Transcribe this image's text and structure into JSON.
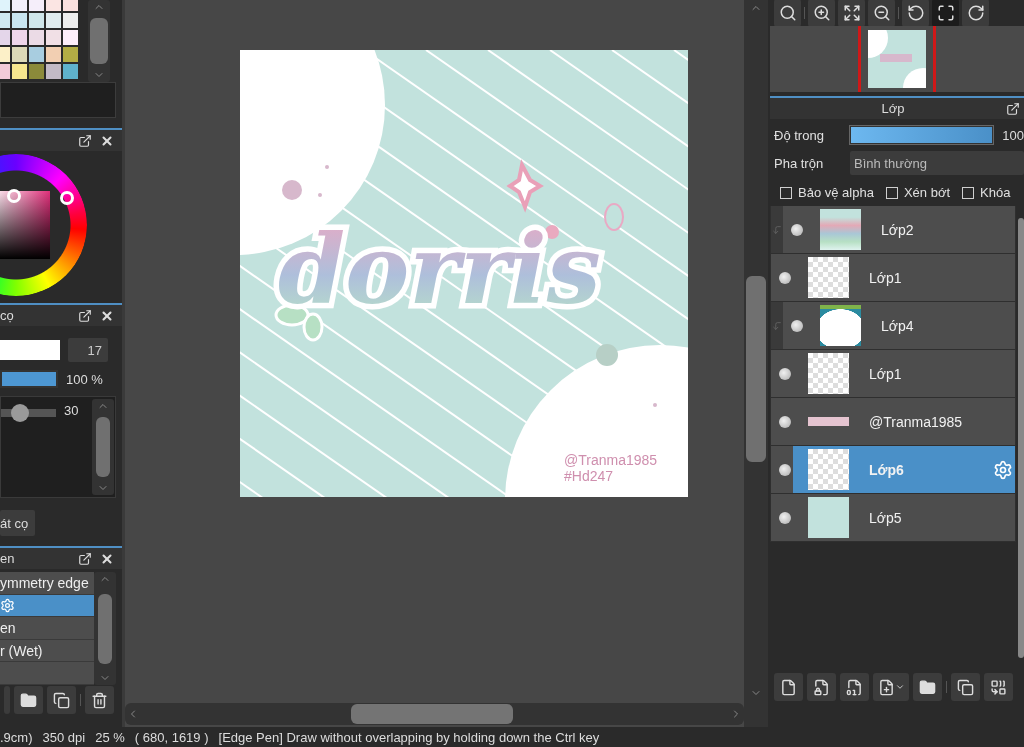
{
  "palette": {
    "swatches": [
      {
        "color": "#dff3fb"
      },
      {
        "color": "#f3f0fb"
      },
      {
        "color": "#f5eefa"
      },
      {
        "color": "#fbe5e3"
      },
      {
        "color": "#fbe1df"
      },
      {
        "color": "#cfe9f1"
      },
      {
        "color": "#c9e6f1"
      },
      {
        "color": "#cfe6ea"
      },
      {
        "color": "#e0ecef"
      },
      {
        "color": "#eeeeee"
      },
      {
        "color": "#e4d6ea"
      },
      {
        "color": "#eed6ea"
      },
      {
        "color": "#ebdbe6"
      },
      {
        "color": "#f1e0e6"
      },
      {
        "color": "#fdeefa"
      },
      {
        "color": "#fcf0c8"
      },
      {
        "color": "#dcd9b8"
      },
      {
        "color": "#a8cde0"
      },
      {
        "color": "#f2cfb2"
      },
      {
        "color": "#b3ad45"
      },
      {
        "color": "#f3cbd8"
      },
      {
        "color": "#f7e78f"
      },
      {
        "color": "#8b8a3a"
      },
      {
        "color": "#c2bac6"
      },
      {
        "color": "#5fb2cc"
      }
    ]
  },
  "brush_panel": {
    "title": "cọ",
    "size": "17",
    "opacity": {
      "level": 1,
      "reading": "100 %"
    },
    "slider": {
      "level": 0.35,
      "reading": "30"
    },
    "button": "át cọ"
  },
  "brush_list": {
    "title": "en",
    "items": [
      {
        "label": "ymmetry edge",
        "selected": false
      },
      {
        "selected": true
      },
      {
        "label": "en",
        "selected": false
      },
      {
        "label": "r (Wet)",
        "selected": false
      },
      {
        "selected": false
      }
    ]
  },
  "view_tools": [
    {
      "kind": "zoom-actual",
      "selected": false
    },
    {
      "kind": "zoom-in",
      "selected": false
    },
    {
      "kind": "fit",
      "selected": false
    },
    {
      "kind": "zoom-out",
      "selected": false
    },
    {
      "kind": "rotate-left",
      "selected": false
    },
    {
      "kind": "full",
      "selected": true
    },
    {
      "kind": "rotate-right",
      "selected": false
    }
  ],
  "canvas": {
    "lettering": "dorris",
    "credits": [
      "@Tranma1985",
      "#Hd247"
    ]
  },
  "layer_panel": {
    "title": "Lớp",
    "opacity": {
      "label": "Độ trong",
      "level": 1,
      "reading": "100"
    },
    "blend": {
      "label": "Pha trộn",
      "value": "Bình thường"
    },
    "options": [
      {
        "label": "Bảo vệ alpha",
        "checked": false
      },
      {
        "label": "Xén bớt",
        "checked": false
      },
      {
        "label": "Khóa",
        "checked": false
      }
    ],
    "layers": [
      {
        "name": "Lớp2",
        "kind": "art",
        "clipped": true,
        "selected": false
      },
      {
        "name": "Lớp1",
        "kind": "checker",
        "clipped": false,
        "selected": false
      },
      {
        "name": "Lớp4",
        "kind": "blob",
        "clipped": true,
        "selected": false
      },
      {
        "name": "Lớp1",
        "kind": "checker",
        "clipped": false,
        "selected": false
      },
      {
        "name": "@Tranma1985",
        "kind": "strip",
        "clipped": false,
        "selected": false
      },
      {
        "name": "Lớp6",
        "kind": "checker",
        "clipped": false,
        "selected": true
      },
      {
        "name": "Lớp5",
        "kind": "teal",
        "clipped": false,
        "selected": false
      }
    ]
  },
  "status_bar": {
    "items": [
      ".9cm)",
      "350 dpi",
      "25 %",
      "( 680, 1619 )",
      "[Edge Pen] Draw without overlapping by holding down the Ctrl key"
    ]
  }
}
